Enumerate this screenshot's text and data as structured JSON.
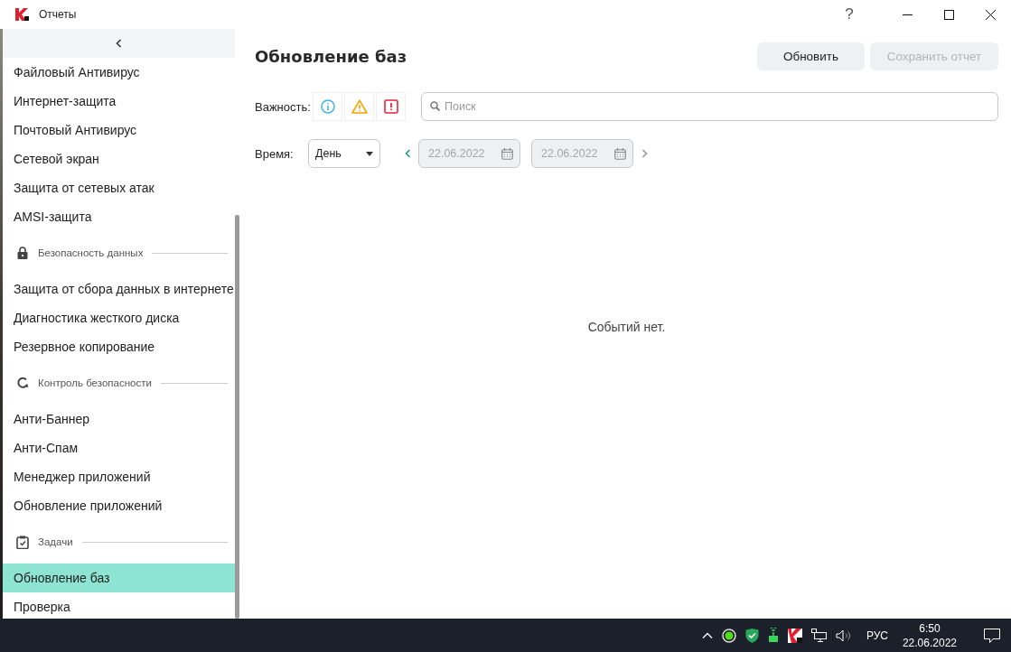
{
  "window": {
    "title": "Отчеты",
    "help": "?"
  },
  "sidebar": {
    "items": [
      {
        "kind": "item",
        "label": "Файловый Антивирус",
        "selected": false
      },
      {
        "kind": "item",
        "label": "Интернет-защита",
        "selected": false
      },
      {
        "kind": "item",
        "label": "Почтовый Антивирус",
        "selected": false
      },
      {
        "kind": "item",
        "label": "Сетевой экран",
        "selected": false
      },
      {
        "kind": "item",
        "label": "Защита от сетевых атак",
        "selected": false
      },
      {
        "kind": "item",
        "label": "AMSI-защита",
        "selected": false
      },
      {
        "kind": "section",
        "label": "Безопасность данных"
      },
      {
        "kind": "item",
        "label": "Защита от сбора данных в интернете",
        "selected": false
      },
      {
        "kind": "item",
        "label": "Диагностика жесткого диска",
        "selected": false
      },
      {
        "kind": "item",
        "label": "Резервное копирование",
        "selected": false
      },
      {
        "kind": "section",
        "label": "Контроль безопасности"
      },
      {
        "kind": "item",
        "label": "Анти-Баннер",
        "selected": false
      },
      {
        "kind": "item",
        "label": "Анти-Спам",
        "selected": false
      },
      {
        "kind": "item",
        "label": "Менеджер приложений",
        "selected": false
      },
      {
        "kind": "item",
        "label": "Обновление приложений",
        "selected": false
      },
      {
        "kind": "section",
        "label": "Задачи"
      },
      {
        "kind": "item",
        "label": "Обновление баз",
        "selected": true
      },
      {
        "kind": "item",
        "label": "Проверка",
        "selected": false
      }
    ]
  },
  "main": {
    "title": "Обновление баз",
    "buttons": [
      {
        "label": "Обновить",
        "disabled": false
      },
      {
        "label": "Сохранить отчет",
        "disabled": true
      }
    ],
    "severity_label": "Важность:",
    "search": {
      "placeholder": "Поиск"
    },
    "time_label": "Время:",
    "period": {
      "value": "День"
    },
    "date_from": {
      "value": "22.06.2022",
      "disabled": true
    },
    "date_to": {
      "value": "22.06.2022",
      "disabled": true
    },
    "empty_message": "Событий нет."
  },
  "taskbar": {
    "language": "РУС",
    "time": "6:50",
    "date": "22.06.2022"
  }
}
